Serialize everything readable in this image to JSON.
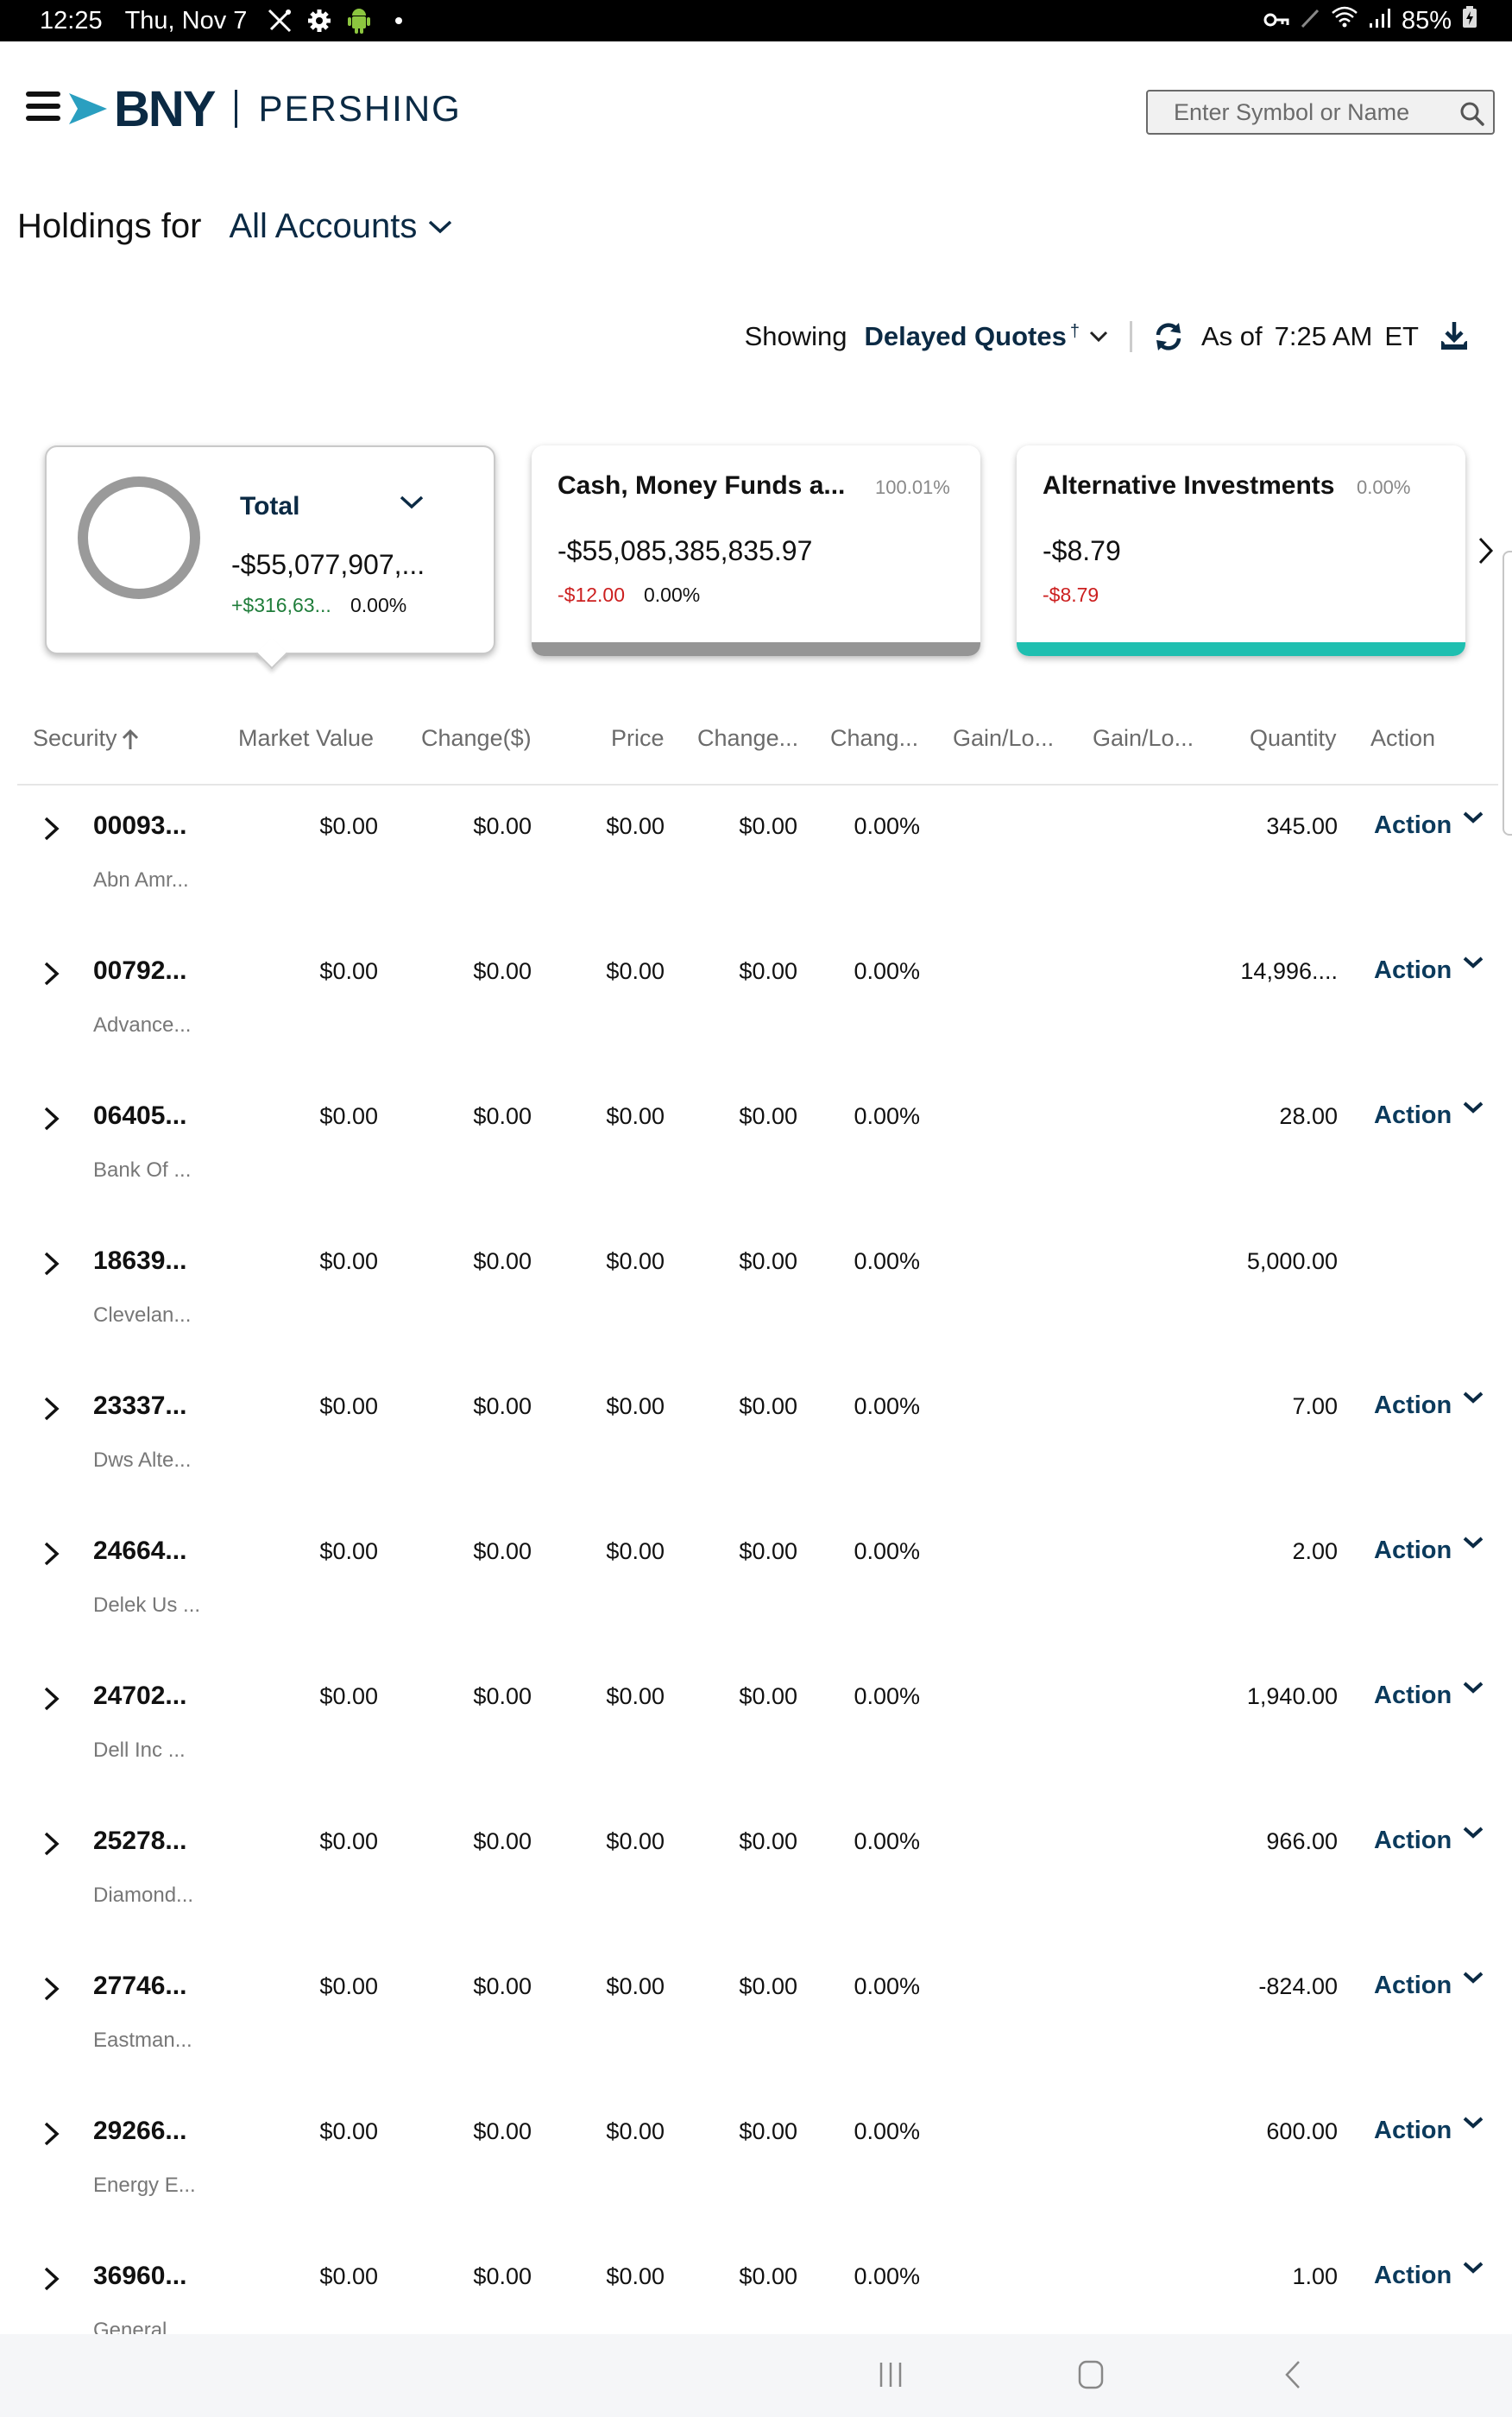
{
  "status_bar": {
    "time": "12:25",
    "date": "Thu, Nov 7",
    "left_icons": [
      "tools-icon",
      "settings-icon",
      "android-icon",
      "dot-icon"
    ],
    "right_icons": [
      "vpn-key-icon",
      "pen-icon",
      "wifi-icon",
      "signal-icon"
    ],
    "battery": "85%"
  },
  "header": {
    "brand": "BNY",
    "sub_brand": "PERSHING",
    "search": {
      "placeholder": "Enter Symbol or Name",
      "value": ""
    }
  },
  "holdings": {
    "label": "Holdings for",
    "account": "All Accounts"
  },
  "quotes": {
    "showing_label": "Showing",
    "mode": "Delayed Quotes",
    "mode_mark": "†",
    "as_of_label": "As of",
    "time": "7:25 AM",
    "tz": "ET"
  },
  "cards": {
    "total": {
      "title": "Total",
      "value": "-$55,077,907,...",
      "change": "+$316,63...",
      "change_pct": "0.00%"
    },
    "items": [
      {
        "title": "Cash, Money Funds a...",
        "share": "100.01%",
        "value": "-$55,085,385,835.97",
        "change": "-$12.00",
        "change_pct": "0.00%",
        "color": "#959595"
      },
      {
        "title": "Alternative Investments",
        "share": "0.00%",
        "value": "-$8.79",
        "change": "-$8.79",
        "change_pct": "",
        "color": "#1fbfb0"
      }
    ]
  },
  "table": {
    "columns": [
      "Security",
      "Market Value",
      "Change($)",
      "Price",
      "Change...",
      "Chang...",
      "Gain/Lo...",
      "Gain/Lo...",
      "Quantity",
      "Action"
    ],
    "rows": [
      {
        "symbol": "00093...",
        "name": "Abn Amr...",
        "market_value": "$0.00",
        "change": "$0.00",
        "price": "$0.00",
        "change2": "$0.00",
        "change_pct": "0.00%",
        "quantity": "345.00",
        "action": "Action"
      },
      {
        "symbol": "00792...",
        "name": "Advance...",
        "market_value": "$0.00",
        "change": "$0.00",
        "price": "$0.00",
        "change2": "$0.00",
        "change_pct": "0.00%",
        "quantity": "14,996....",
        "action": "Action"
      },
      {
        "symbol": "06405...",
        "name": "Bank Of ...",
        "market_value": "$0.00",
        "change": "$0.00",
        "price": "$0.00",
        "change2": "$0.00",
        "change_pct": "0.00%",
        "quantity": "28.00",
        "action": "Action"
      },
      {
        "symbol": "18639...",
        "name": "Clevelan...",
        "market_value": "$0.00",
        "change": "$0.00",
        "price": "$0.00",
        "change2": "$0.00",
        "change_pct": "0.00%",
        "quantity": "5,000.00",
        "action": ""
      },
      {
        "symbol": "23337...",
        "name": "Dws Alte...",
        "market_value": "$0.00",
        "change": "$0.00",
        "price": "$0.00",
        "change2": "$0.00",
        "change_pct": "0.00%",
        "quantity": "7.00",
        "action": "Action"
      },
      {
        "symbol": "24664...",
        "name": "Delek Us ...",
        "market_value": "$0.00",
        "change": "$0.00",
        "price": "$0.00",
        "change2": "$0.00",
        "change_pct": "0.00%",
        "quantity": "2.00",
        "action": "Action"
      },
      {
        "symbol": "24702...",
        "name": "Dell Inc ...",
        "market_value": "$0.00",
        "change": "$0.00",
        "price": "$0.00",
        "change2": "$0.00",
        "change_pct": "0.00%",
        "quantity": "1,940.00",
        "action": "Action"
      },
      {
        "symbol": "25278...",
        "name": "Diamond...",
        "market_value": "$0.00",
        "change": "$0.00",
        "price": "$0.00",
        "change2": "$0.00",
        "change_pct": "0.00%",
        "quantity": "966.00",
        "action": "Action"
      },
      {
        "symbol": "27746...",
        "name": "Eastman...",
        "market_value": "$0.00",
        "change": "$0.00",
        "price": "$0.00",
        "change2": "$0.00",
        "change_pct": "0.00%",
        "quantity": "-824.00",
        "action": "Action"
      },
      {
        "symbol": "29266...",
        "name": "Energy E...",
        "market_value": "$0.00",
        "change": "$0.00",
        "price": "$0.00",
        "change2": "$0.00",
        "change_pct": "0.00%",
        "quantity": "600.00",
        "action": "Action"
      },
      {
        "symbol": "36960...",
        "name": "General ...",
        "market_value": "$0.00",
        "change": "$0.00",
        "price": "$0.00",
        "change2": "$0.00",
        "change_pct": "0.00%",
        "quantity": "1.00",
        "action": "Action"
      }
    ]
  },
  "colors": {
    "brand_navy": "#0b2a44",
    "brand_teal": "#2a9fc0",
    "positive": "#1f7d3a",
    "negative": "#cc1f1f",
    "alt_investments": "#1fbfb0",
    "cash": "#959595"
  }
}
